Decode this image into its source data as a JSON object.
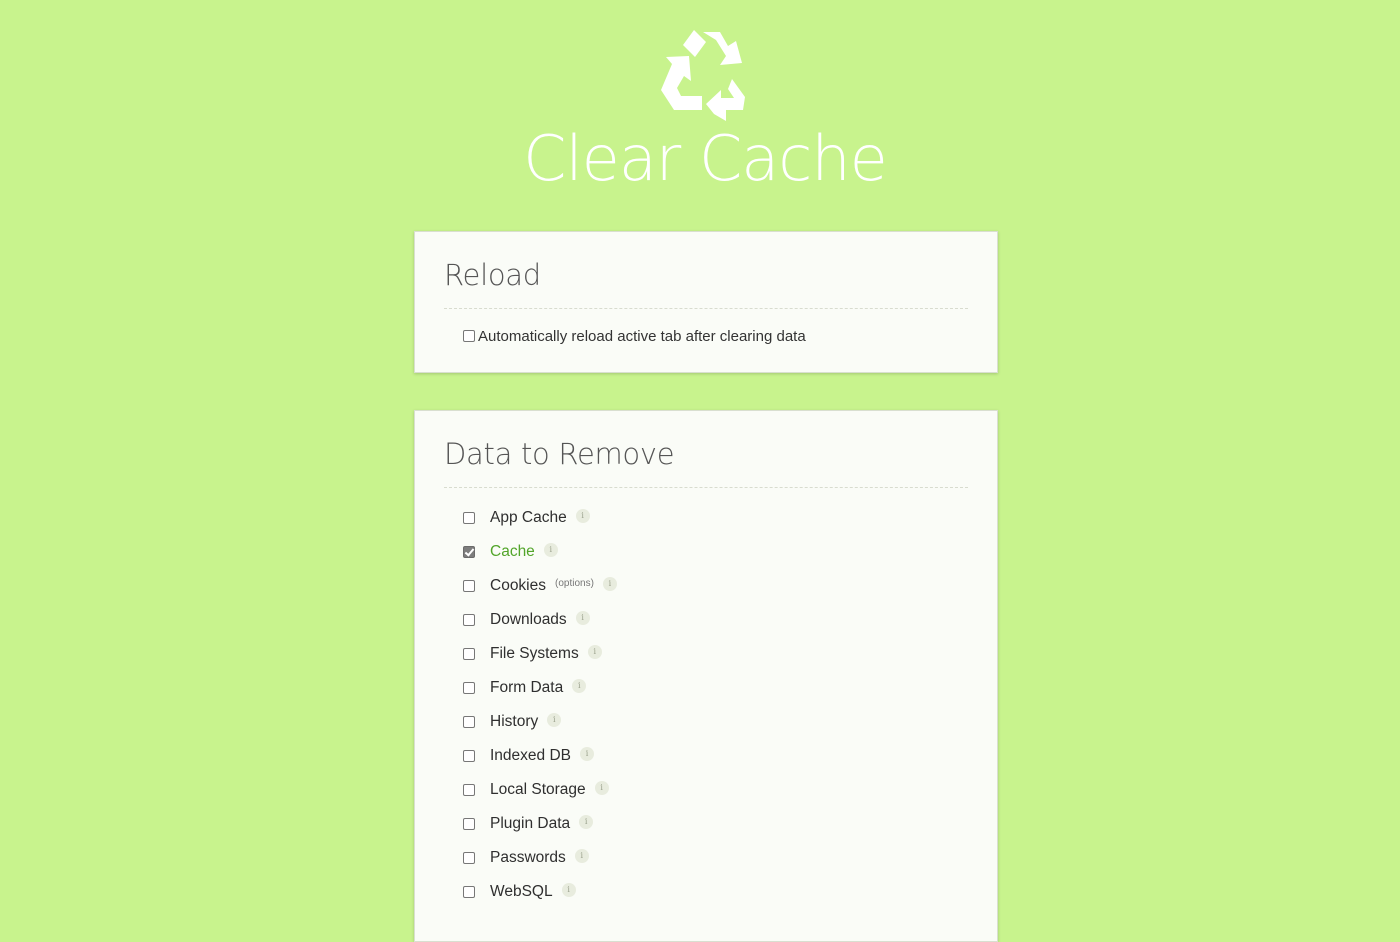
{
  "app": {
    "title": "Clear Cache",
    "logo_icon": "recycle-icon"
  },
  "reload": {
    "title": "Reload",
    "auto_reload_label": "Automatically reload active tab after clearing data",
    "auto_reload_checked": false
  },
  "data_to_remove": {
    "title": "Data to Remove",
    "info_glyph": "i",
    "items": [
      {
        "label": "App Cache",
        "checked": false
      },
      {
        "label": "Cache",
        "checked": true
      },
      {
        "label": "Cookies",
        "checked": false,
        "extra": "(options)"
      },
      {
        "label": "Downloads",
        "checked": false
      },
      {
        "label": "File Systems",
        "checked": false
      },
      {
        "label": "Form Data",
        "checked": false
      },
      {
        "label": "History",
        "checked": false
      },
      {
        "label": "Indexed DB",
        "checked": false
      },
      {
        "label": "Local Storage",
        "checked": false
      },
      {
        "label": "Plugin Data",
        "checked": false
      },
      {
        "label": "Passwords",
        "checked": false
      },
      {
        "label": "WebSQL",
        "checked": false
      }
    ]
  },
  "colors": {
    "background": "#c8f38d",
    "card": "#fafcf7",
    "active_label": "#52a52a"
  }
}
